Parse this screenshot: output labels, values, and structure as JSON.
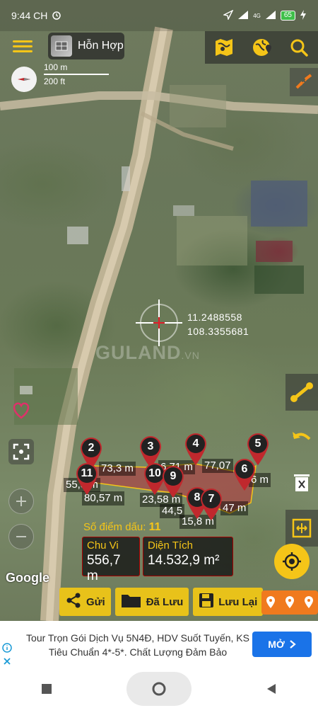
{
  "status": {
    "time": "9:44 CH",
    "network": "4G",
    "battery": "65"
  },
  "toolbar": {
    "map_type": "Hỗn Hợp",
    "icons": [
      "menu-icon",
      "map-icon",
      "globe-pin-icon",
      "search-icon"
    ]
  },
  "scale": {
    "metric": "100 m",
    "imperial": "200 ft"
  },
  "coords": {
    "lat": "11.2488558",
    "lng": "108.3355681"
  },
  "watermark": {
    "brand": "GULAND",
    "suffix": ".VN"
  },
  "markers": {
    "labels": [
      "2",
      "11",
      "3",
      "10",
      "9",
      "4",
      "8",
      "7",
      "6",
      "5"
    ],
    "color": "#c0282d"
  },
  "measurements": {
    "m1": "73,3 m",
    "m2": "6,71 m",
    "m3": "77,07",
    "m4": "55,8 m",
    "m5": "80,57 m",
    "m6": "23,58 m",
    "m7": "44,5",
    "m8": "47 m",
    "m9": "15,8 m",
    "m10": "6 m"
  },
  "stats": {
    "points_label": "Số điểm dấu:",
    "points_value": "11",
    "perimeter_label": "Chu Vi",
    "perimeter_value": "556,7 m",
    "area_label": "Diện Tích",
    "area_value": "14.532,9 m²"
  },
  "google_logo": "Google",
  "actions": {
    "send": "Gửi",
    "saved": "Đã Lưu",
    "save": "Lưu Lại"
  },
  "ad": {
    "text": "Tour Trọn Gói Dịch Vụ 5N4Đ, HDV Suốt Tuyến, KS Tiêu Chuẩn 4*-5*. Chất Lượng Đảm Bảo",
    "cta": "MỞ"
  },
  "colors": {
    "accent": "#f5c518",
    "polygon": "#c0282d",
    "ad_cta": "#1a73e8",
    "pins_button": "#f07a1e"
  }
}
